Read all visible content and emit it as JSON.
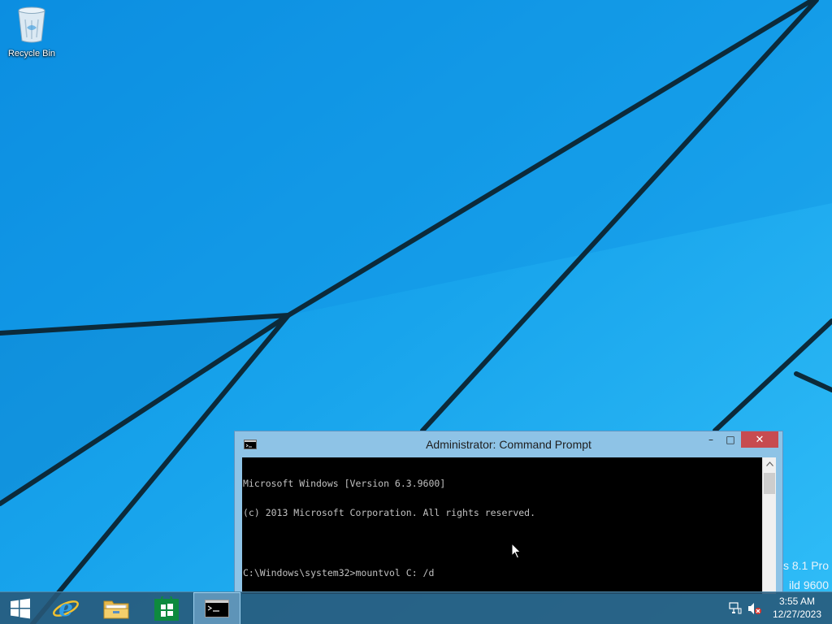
{
  "desktop": {
    "icons": [
      {
        "label": "Recycle Bin",
        "icon": "recycle-bin-icon"
      }
    ],
    "watermark": {
      "line1": "s 8.1 Pro",
      "line2": "ild 9600"
    }
  },
  "window": {
    "title": "Administrator: Command Prompt",
    "controls": {
      "minimize": "–",
      "maximize": "□",
      "close": "✕"
    },
    "console_lines": [
      "Microsoft Windows [Version 6.3.9600]",
      "(c) 2013 Microsoft Corporation. All rights reserved.",
      "",
      "C:\\Windows\\system32>mountvol C: /d"
    ]
  },
  "taskbar": {
    "items": [
      {
        "name": "start",
        "icon": "windows-logo-icon"
      },
      {
        "name": "internet-explorer",
        "icon": "internet-explorer-icon"
      },
      {
        "name": "file-explorer",
        "icon": "folder-icon"
      },
      {
        "name": "store",
        "icon": "store-icon"
      },
      {
        "name": "command-prompt",
        "icon": "command-prompt-icon",
        "active": true
      }
    ],
    "tray": {
      "network_icon": "network-icon",
      "volume_icon": "volume-muted-icon"
    },
    "clock": {
      "time": "3:55 AM",
      "date": "12/27/2023"
    }
  },
  "colors": {
    "wallpaper": "#1aa7ee",
    "close_button": "#c74b50",
    "console_background": "#000000",
    "console_text": "#c0c0c0"
  }
}
